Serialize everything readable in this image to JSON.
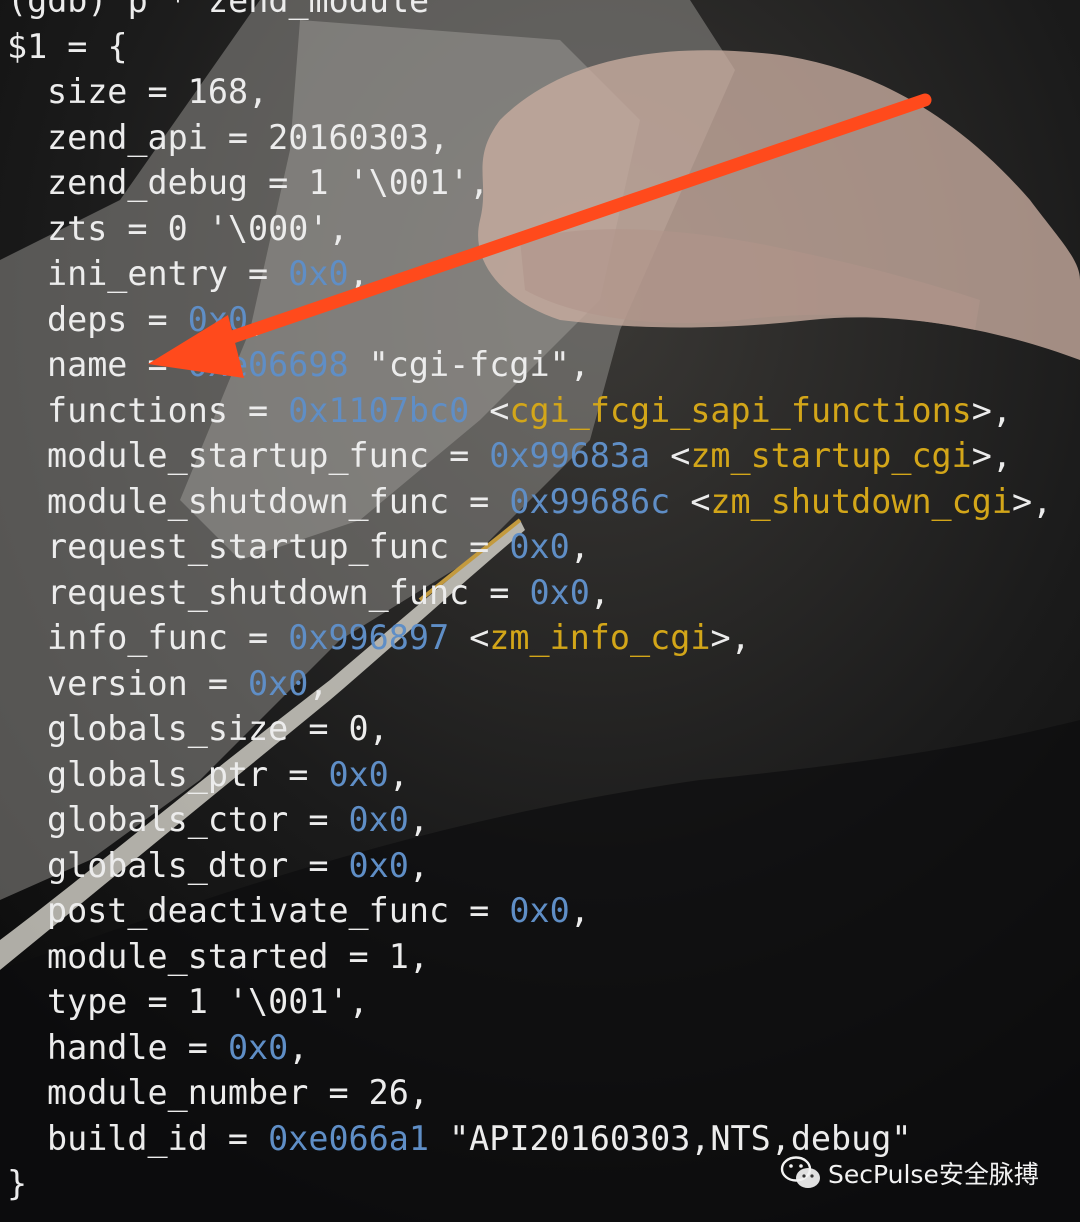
{
  "terminal": {
    "command": "(gdb) p * zend_module",
    "result_open": "$1 = {",
    "closing": "}",
    "fields": [
      {
        "name": "size",
        "value": "168"
      },
      {
        "name": "zend_api",
        "value": "20160303"
      },
      {
        "name": "zend_debug",
        "value": "1 '\\001'"
      },
      {
        "name": "zts",
        "value": "0 '\\000'"
      },
      {
        "name": "ini_entry",
        "addr": "0x0"
      },
      {
        "name": "deps",
        "addr": "0x0"
      },
      {
        "name": "name",
        "addr": "0xe06698",
        "value": "\"cgi-fcgi\""
      },
      {
        "name": "functions",
        "addr": "0x1107bc0",
        "symbol": "cgi_fcgi_sapi_functions"
      },
      {
        "name": "module_startup_func",
        "addr": "0x99683a",
        "symbol": "zm_startup_cgi"
      },
      {
        "name": "module_shutdown_func",
        "addr": "0x99686c",
        "symbol": "zm_shutdown_cgi"
      },
      {
        "name": "request_startup_func",
        "addr": "0x0"
      },
      {
        "name": "request_shutdown_func",
        "addr": "0x0"
      },
      {
        "name": "info_func",
        "addr": "0x996897",
        "symbol": "zm_info_cgi"
      },
      {
        "name": "version",
        "addr": "0x0"
      },
      {
        "name": "globals_size",
        "value": "0"
      },
      {
        "name": "globals_ptr",
        "addr": "0x0"
      },
      {
        "name": "globals_ctor",
        "addr": "0x0"
      },
      {
        "name": "globals_dtor",
        "addr": "0x0"
      },
      {
        "name": "post_deactivate_func",
        "addr": "0x0"
      },
      {
        "name": "module_started",
        "value": "1"
      },
      {
        "name": "type",
        "value": "1 '\\001'"
      },
      {
        "name": "handle",
        "addr": "0x0"
      },
      {
        "name": "module_number",
        "value": "26"
      },
      {
        "name": "build_id",
        "addr": "0xe066a1",
        "value": "\"API20160303,NTS,debug\"",
        "last": true
      }
    ]
  },
  "annotation": {
    "icon": "arrow-icon",
    "target_field": "name",
    "color": "#ff4a1c"
  },
  "watermark": {
    "icon": "wechat-icon",
    "text": "SecPulse安全脉搏"
  },
  "colors": {
    "background": "#0b0b0c",
    "text": "#ececec",
    "address": "#5f8ec6",
    "symbol": "#d3a619"
  }
}
